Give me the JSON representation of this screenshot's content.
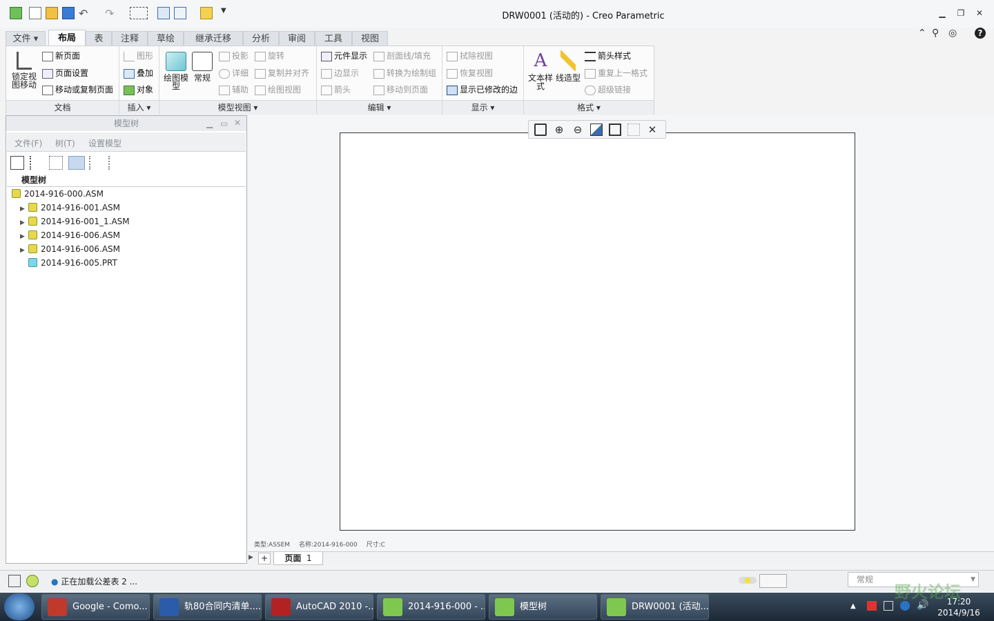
{
  "window": {
    "title": "DRW0001 (活动的) - Creo Parametric"
  },
  "tabs": [
    "文件",
    "布局",
    "表",
    "注释",
    "草绘",
    "继承迁移",
    "分析",
    "审阅",
    "工具",
    "视图"
  ],
  "ribbon": {
    "groups": {
      "doc": "文档",
      "insert": "插入",
      "model_views": "模型视图",
      "edit": "编辑",
      "display": "显示",
      "format": "格式"
    },
    "doc": {
      "lock": "锁定视图移动",
      "new_page": "新页面",
      "page_setup": "页面设置",
      "move_copy_page": "移动或复制页面"
    },
    "insert": {
      "graph": "图形",
      "overlay": "叠加",
      "object": "对象"
    },
    "model_views": {
      "drawing_model": "绘图模型",
      "general": "常规",
      "projection": "投影",
      "detail": "详细",
      "auxiliary": "辅助",
      "revolve": "旋转",
      "copy_align": "复制并对齐",
      "drawing_view": "绘图视图"
    },
    "edit": {
      "component_display": "元件显示",
      "edge_display": "边显示",
      "arrow": "箭头",
      "section_hatch": "剖面线/填充",
      "convert_group": "转换为绘制组",
      "move_to_page": "移动到页面"
    },
    "display": {
      "erase_view": "拭除视图",
      "resume_view": "恢复视图",
      "show_modified_edges": "显示已修改的边"
    },
    "format": {
      "text_style": "文本样式",
      "line_style": "线造型",
      "arrow_style": "箭头样式",
      "repeat_format": "重复上一格式",
      "hyperlink": "超级链接"
    }
  },
  "model_tree": {
    "title": "模型树",
    "menu": [
      "文件(F)",
      "树(T)",
      "设置模型"
    ],
    "column_header": "模型树",
    "nodes": [
      {
        "label": "2014-916-000.ASM",
        "level": 0,
        "expandable": false
      },
      {
        "label": "2014-916-001.ASM",
        "level": 1,
        "expandable": true
      },
      {
        "label": "2014-916-001_1.ASM",
        "level": 1,
        "expandable": true
      },
      {
        "label": "2014-916-006.ASM",
        "level": 1,
        "expandable": true
      },
      {
        "label": "2014-916-006.ASM",
        "level": 1,
        "expandable": true
      },
      {
        "label": "2014-916-005.PRT",
        "level": 1,
        "expandable": false
      }
    ]
  },
  "drawing_info": {
    "type": "类型:ASSEM",
    "name": "名称:2014-916-000",
    "size": "尺寸:C"
  },
  "page_tabs": {
    "add": "+",
    "page_label": "页面",
    "page_number": "1"
  },
  "status": {
    "message": "正在加载公差表 2 ...",
    "filter": "常规"
  },
  "taskbar": {
    "items": [
      "Google - Como...",
      "轨80合同内清单....",
      "AutoCAD 2010 -...",
      "2014-916-000 - ...",
      "模型树",
      "DRW0001 (活动..."
    ],
    "time": "17:20",
    "date": "2014/9/16"
  },
  "watermark": "野火论坛",
  "colors": {
    "accent": "#2a72c4",
    "taskbar": "#243446",
    "sheet_border": "#333333"
  }
}
